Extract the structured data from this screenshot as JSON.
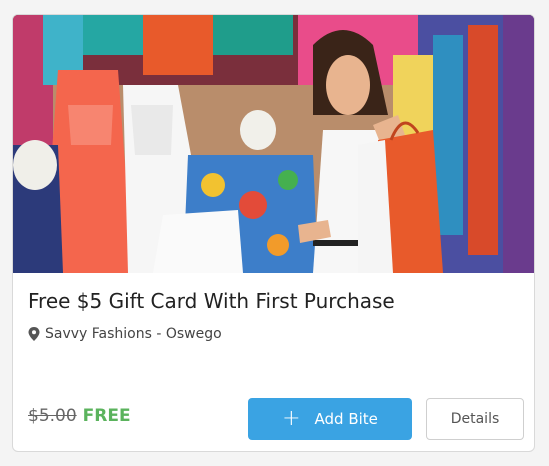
{
  "offer": {
    "title": "Free $5 Gift Card With First Purchase",
    "location": "Savvy Fashions - Oswego",
    "original_price": "$5.00",
    "price_label": "FREE",
    "add_button_label": "Add Bite",
    "details_button_label": "Details"
  },
  "colors": {
    "accent_blue": "#3aa3e3",
    "free_green": "#5bb35d"
  },
  "icons": {
    "location": "map-pin-icon",
    "add": "plus-icon"
  }
}
